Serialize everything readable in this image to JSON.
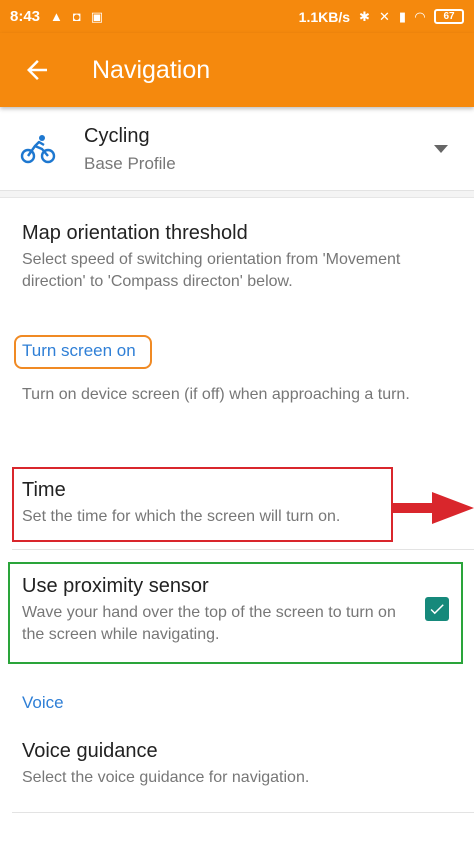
{
  "status_bar": {
    "time": "8:43",
    "speed": "1.1KB/s",
    "battery": "67"
  },
  "app_bar": {
    "title": "Navigation",
    "back_icon": "arrow-left-icon"
  },
  "profile": {
    "name": "Cycling",
    "subtitle": "Base Profile",
    "icon": "bicycle-icon"
  },
  "settings": {
    "map_orientation": {
      "title": "Map orientation threshold",
      "desc": "Select speed of switching orientation from 'Movement direction' to 'Compass directon' below."
    },
    "turn_screen_section": "Turn screen on",
    "turn_screen_desc": "Turn on device screen (if off) when approaching a turn.",
    "time": {
      "title": "Time",
      "desc": "Set the time for which the screen will turn on."
    },
    "proximity": {
      "title": "Use proximity sensor",
      "desc": "Wave your hand over the top of the screen to turn on the screen while navigating.",
      "checked": true
    },
    "voice_section": "Voice",
    "voice_guidance": {
      "title": "Voice guidance",
      "desc": "Select the voice guidance for navigation."
    }
  },
  "colors": {
    "accent": "#f5890d",
    "section_text": "#2f7fd6",
    "checkbox": "#16897b",
    "highlight_orange": "#f08a24",
    "highlight_red": "#d9262c",
    "highlight_green": "#2aa43a"
  }
}
